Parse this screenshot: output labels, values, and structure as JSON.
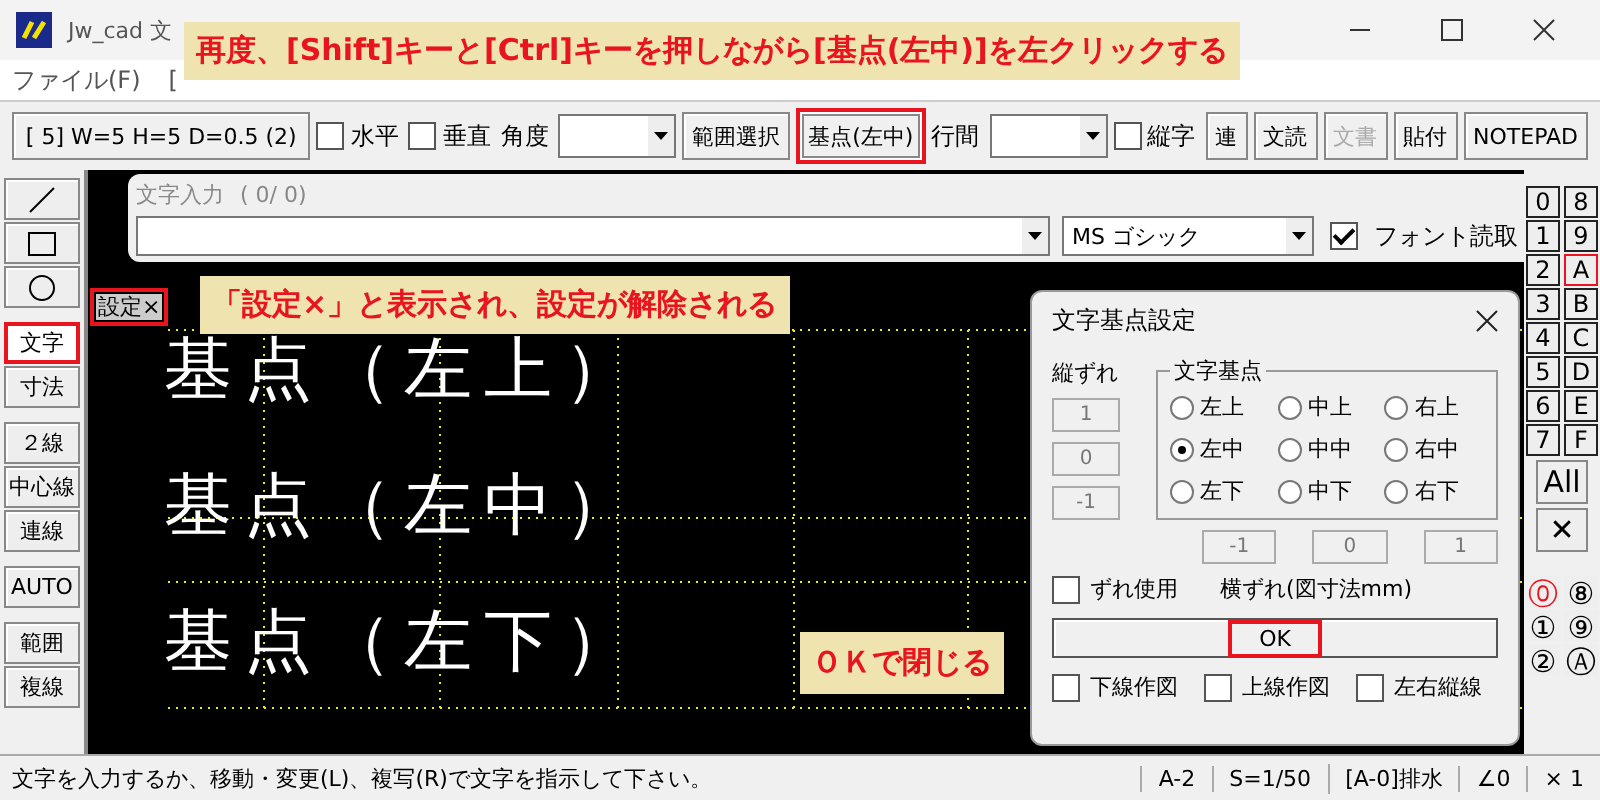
{
  "window": {
    "title": "Jw_cad 文"
  },
  "menu": [
    "ファイル(F)",
    "["
  ],
  "toolbar": [
    {
      "kind": "button",
      "label": "[ 5]  W=5 H=5 D=0.5 (2)",
      "disabled": false,
      "highlighted": false
    },
    {
      "kind": "checkbox",
      "label": "水平",
      "checked": false
    },
    {
      "kind": "checkbox",
      "label": "垂直",
      "checked": false
    },
    {
      "kind": "label",
      "label": "角度"
    },
    {
      "kind": "combo"
    },
    {
      "kind": "button",
      "label": "範囲選択",
      "disabled": false,
      "highlighted": false
    },
    {
      "kind": "button",
      "label": "基点(左中)",
      "disabled": false,
      "highlighted": true
    },
    {
      "kind": "label",
      "label": "行間"
    },
    {
      "kind": "combo"
    },
    {
      "kind": "checkbox",
      "label": "縦字",
      "checked": false
    },
    {
      "kind": "button",
      "label": "連",
      "disabled": false,
      "highlighted": false
    },
    {
      "kind": "button",
      "label": "文読",
      "disabled": false,
      "highlighted": false
    },
    {
      "kind": "button",
      "label": "文書",
      "disabled": true,
      "highlighted": false
    },
    {
      "kind": "button",
      "label": "貼付",
      "disabled": false,
      "highlighted": false
    },
    {
      "kind": "button",
      "label": "NOTEPAD",
      "disabled": false,
      "highlighted": false
    }
  ],
  "tools": [
    {
      "kind": "line",
      "selected": false,
      "highlighted": false
    },
    {
      "kind": "rect",
      "selected": false,
      "highlighted": false
    },
    {
      "kind": "circle",
      "selected": false,
      "highlighted": false
    },
    {
      "kind": "text",
      "label": "文字",
      "selected": true,
      "highlighted": true
    },
    {
      "kind": "text",
      "label": "寸法",
      "selected": false,
      "highlighted": false
    },
    {
      "kind": "text",
      "label": "２線",
      "selected": false,
      "highlighted": false
    },
    {
      "kind": "text",
      "label": "中心線",
      "selected": false,
      "highlighted": false
    },
    {
      "kind": "text",
      "label": "連線",
      "selected": false,
      "highlighted": false
    },
    {
      "kind": "text",
      "label": "AUTO",
      "selected": false,
      "highlighted": false
    },
    {
      "kind": "text",
      "label": "範囲",
      "selected": false,
      "highlighted": false
    },
    {
      "kind": "text",
      "label": "複線",
      "selected": false,
      "highlighted": false
    }
  ],
  "text_input": {
    "label": "文字入力",
    "count": "( 0/  0)",
    "font": "MS ゴシック",
    "font_read": {
      "label": "フォント読取",
      "checked": true
    }
  },
  "setting_badge": {
    "label": "設定×",
    "highlighted": true
  },
  "canvas_texts": [
    "基点（左上）",
    "基点（左中）",
    "基点（左下）"
  ],
  "callouts": [
    {
      "text": "再度、[Shift]キーと[Ctrl]キーを押しながら[基点(左中)]を左クリックする"
    },
    {
      "text": "「設定×」と表示され、設定が解除される"
    },
    {
      "text": "ＯＫで閉じる"
    }
  ],
  "dialog": {
    "title": "文字基点設定",
    "vertical_label": "縦ずれ",
    "vertical_fields": [
      "1",
      "0",
      "-1"
    ],
    "group_label": "文字基点",
    "points": [
      {
        "label": "左上",
        "selected": false
      },
      {
        "label": "中上",
        "selected": false
      },
      {
        "label": "右上",
        "selected": false
      },
      {
        "label": "左中",
        "selected": true
      },
      {
        "label": "中中",
        "selected": false
      },
      {
        "label": "右中",
        "selected": false
      },
      {
        "label": "左下",
        "selected": false
      },
      {
        "label": "中下",
        "selected": false
      },
      {
        "label": "右下",
        "selected": false
      }
    ],
    "horizontal_fields": [
      "-1",
      "0",
      "1"
    ],
    "use_offset": {
      "label": "ずれ使用",
      "checked": false
    },
    "horizontal_label": "横ずれ(図寸法mm)",
    "ok": {
      "label": "OK",
      "highlighted": true
    },
    "options": [
      {
        "label": "下線作図",
        "checked": false
      },
      {
        "label": "上線作図",
        "checked": false
      },
      {
        "label": "左右縦線",
        "checked": false
      }
    ]
  },
  "layers": [
    {
      "label": "0",
      "selected": false
    },
    {
      "label": "8",
      "selected": false
    },
    {
      "label": "1",
      "selected": false
    },
    {
      "label": "9",
      "selected": false
    },
    {
      "label": "2",
      "selected": false
    },
    {
      "label": "A",
      "selected": true
    },
    {
      "label": "3",
      "selected": false
    },
    {
      "label": "B",
      "selected": false
    },
    {
      "label": "4",
      "selected": false
    },
    {
      "label": "C",
      "selected": false
    },
    {
      "label": "5",
      "selected": false
    },
    {
      "label": "D",
      "selected": false
    },
    {
      "label": "6",
      "selected": false
    },
    {
      "label": "E",
      "selected": false
    },
    {
      "label": "7",
      "selected": false
    },
    {
      "label": "F",
      "selected": false
    }
  ],
  "layer_buttons": [
    "All",
    "✕"
  ],
  "layer_groups": [
    {
      "label": "⓪",
      "selected": true
    },
    {
      "label": "⑧",
      "selected": false
    },
    {
      "label": "①",
      "selected": false
    },
    {
      "label": "⑨",
      "selected": false
    },
    {
      "label": "②",
      "selected": false
    },
    {
      "label": "Ⓐ",
      "selected": false
    }
  ],
  "status_bar": {
    "message": "文字を入力するか、移動・変更(L)、複写(R)で文字を指示して下さい。",
    "cells": [
      "A-2",
      "S=1/50",
      "[A-0]排水",
      "∠0",
      "× 1"
    ]
  }
}
